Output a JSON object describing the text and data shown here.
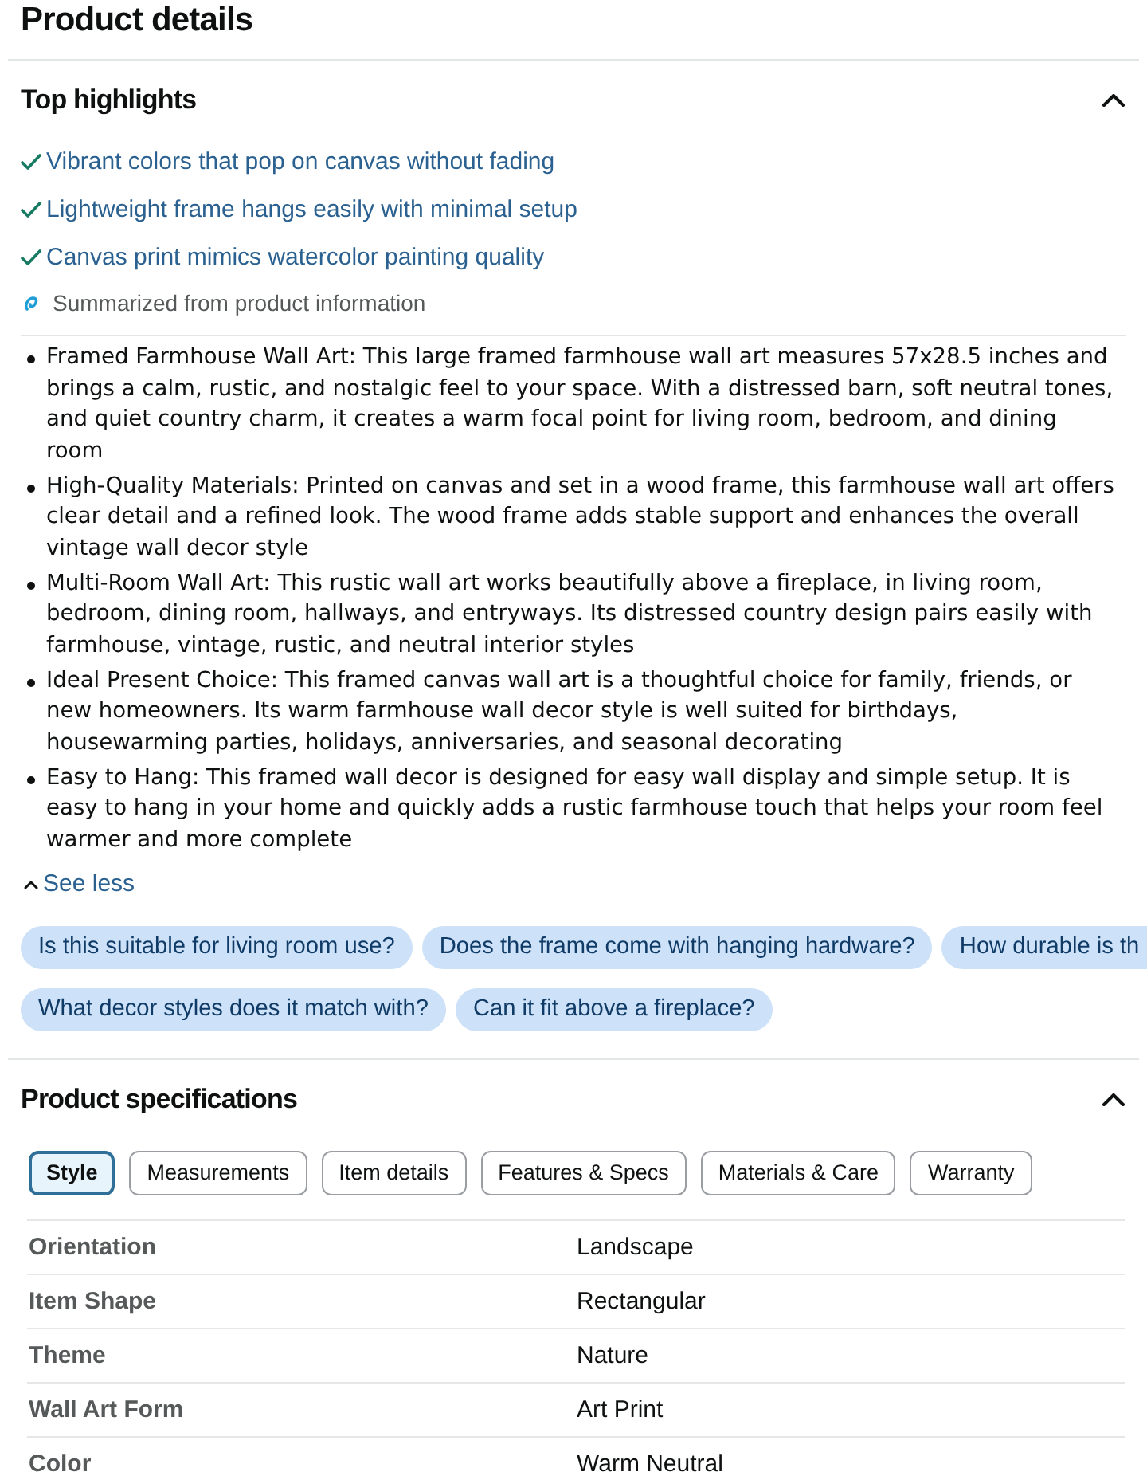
{
  "page_title": "Product details",
  "highlights_section": {
    "title": "Top highlights",
    "expanded": true,
    "highlights": [
      "Vibrant colors that pop on canvas without fading",
      "Lightweight frame hangs easily with minimal setup",
      "Canvas print mimics watercolor painting quality"
    ],
    "summary_note": "Summarized from product information"
  },
  "description_bullets": [
    "Framed Farmhouse Wall Art: This large framed farmhouse wall art measures 57x28.5 inches and brings a calm, rustic, and nostalgic feel to your space. With a distressed barn, soft neutral tones, and quiet country charm, it creates a warm focal point for living room, bedroom, and dining room",
    "High-Quality Materials: Printed on canvas and set in a wood frame, this farmhouse wall art offers clear detail and a refined look. The wood frame adds stable support and enhances the overall vintage wall decor style",
    "Multi-Room Wall Art: This rustic wall art works beautifully above a fireplace, in living room, bedroom, dining room, hallways, and entryways. Its distressed country design pairs easily with farmhouse, vintage, rustic, and neutral interior styles",
    "Ideal Present Choice: This framed canvas wall art is a thoughtful choice for family, friends, or new homeowners. Its warm farmhouse wall decor style is well suited for birthdays, housewarming parties, holidays, anniversaries, and seasonal decorating",
    "Easy to Hang: This framed wall decor is designed for easy wall display and simple setup. It is easy to hang in your home and quickly adds a rustic farmhouse touch that helps your room feel warmer and more complete"
  ],
  "see_less": "See less",
  "suggested_question_rows": [
    [
      "Is this suitable for living room use?",
      "Does the frame come with hanging hardware?",
      "How durable is th"
    ],
    [
      "What decor styles does it match with?",
      "Can it fit above a fireplace?"
    ]
  ],
  "specifications": {
    "title": "Product specifications",
    "expanded": true,
    "tabs": [
      {
        "label": "Style",
        "selected": true
      },
      {
        "label": "Measurements",
        "selected": false
      },
      {
        "label": "Item details",
        "selected": false
      },
      {
        "label": "Features & Specs",
        "selected": false
      },
      {
        "label": "Materials & Care",
        "selected": false
      },
      {
        "label": "Warranty",
        "selected": false
      }
    ],
    "rows": [
      {
        "label": "Orientation",
        "value": "Landscape"
      },
      {
        "label": "Item Shape",
        "value": "Rectangular"
      },
      {
        "label": "Theme",
        "value": "Nature"
      },
      {
        "label": "Wall Art Form",
        "value": "Art Print"
      },
      {
        "label": "Color",
        "value": "Warm Neutral"
      }
    ]
  }
}
